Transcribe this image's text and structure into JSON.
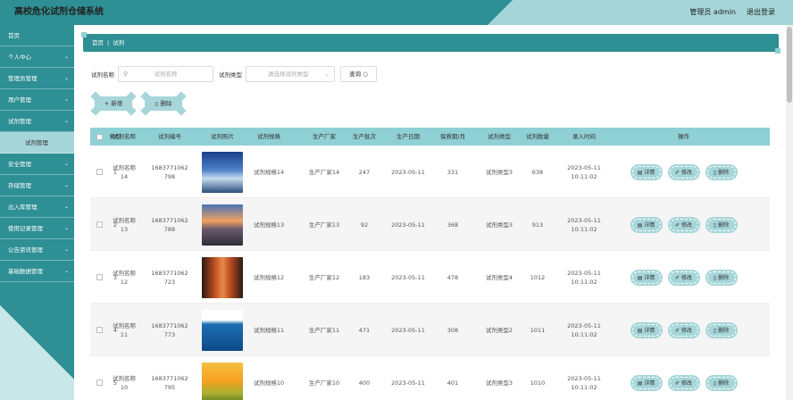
{
  "header": {
    "title": "高校危化试剂仓储系统",
    "user": "管理员 admin",
    "logout": "退出登录"
  },
  "sidebar": {
    "items": [
      {
        "label": "首页",
        "has_chevron": false
      },
      {
        "label": "个人中心",
        "has_chevron": true
      },
      {
        "label": "管理员管理",
        "has_chevron": true
      },
      {
        "label": "用户管理",
        "has_chevron": true
      },
      {
        "label": "试剂管理",
        "has_chevron": true
      },
      {
        "label": "试剂管理",
        "sub": true
      },
      {
        "label": "安全管理",
        "has_chevron": true
      },
      {
        "label": "存储管理",
        "has_chevron": true
      },
      {
        "label": "出入库管理",
        "has_chevron": true
      },
      {
        "label": "使用记录管理",
        "has_chevron": true
      },
      {
        "label": "公告资讯管理",
        "has_chevron": true
      },
      {
        "label": "基础数据管理",
        "has_chevron": true
      }
    ]
  },
  "breadcrumb": {
    "home": "首页",
    "sep": "|",
    "current": "试剂"
  },
  "search": {
    "name_label": "试剂名称",
    "name_placeholder": "试剂名称",
    "type_label": "试剂类型",
    "type_placeholder": "请选择试剂类型",
    "query_button": "查询"
  },
  "actions": {
    "add": "新增",
    "delete": "删除"
  },
  "table": {
    "columns": [
      "索引",
      "试剂名称",
      "试剂编号",
      "试剂照片",
      "试剂规格",
      "生产厂家",
      "生产批次",
      "生产日期",
      "保质期/月",
      "试剂类型",
      "试剂数量",
      "录入时间",
      "操作"
    ],
    "row_buttons": {
      "detail": "详情",
      "edit": "修改",
      "delete": "删除"
    },
    "rows": [
      {
        "index": "1",
        "name": "试剂名称14",
        "code1": "1683771062",
        "code2": "798",
        "img": "img1",
        "spec": "试剂规格14",
        "maker": "生产厂家14",
        "batch": "247",
        "date": "2023-05-11",
        "shelf": "331",
        "type": "试剂类型3",
        "qty": "638",
        "time1": "2023-05-11",
        "time2": "10:11:02"
      },
      {
        "index": "2",
        "name": "试剂名称13",
        "code1": "1683771062",
        "code2": "788",
        "img": "img2",
        "spec": "试剂规格13",
        "maker": "生产厂家13",
        "batch": "92",
        "date": "2023-05-11",
        "shelf": "368",
        "type": "试剂类型3",
        "qty": "913",
        "time1": "2023-05-11",
        "time2": "10:11:02"
      },
      {
        "index": "3",
        "name": "试剂名称12",
        "code1": "1683771062",
        "code2": "723",
        "img": "img3",
        "spec": "试剂规格12",
        "maker": "生产厂家12",
        "batch": "183",
        "date": "2023-05-11",
        "shelf": "478",
        "type": "试剂类型4",
        "qty": "1012",
        "time1": "2023-05-11",
        "time2": "10:11:02"
      },
      {
        "index": "4",
        "name": "试剂名称11",
        "code1": "1683771062",
        "code2": "773",
        "img": "img4",
        "spec": "试剂规格11",
        "maker": "生产厂家11",
        "batch": "471",
        "date": "2023-05-11",
        "shelf": "308",
        "type": "试剂类型2",
        "qty": "1011",
        "time1": "2023-05-11",
        "time2": "10:11:02"
      },
      {
        "index": "5",
        "name": "试剂名称10",
        "code1": "1683771062",
        "code2": "795",
        "img": "img5",
        "spec": "试剂规格10",
        "maker": "生产厂家10",
        "batch": "400",
        "date": "2023-05-11",
        "shelf": "401",
        "type": "试剂类型3",
        "qty": "1010",
        "time1": "2023-05-11",
        "time2": "10:11:02"
      }
    ]
  },
  "icons": {
    "search": "search-icon",
    "chevron": "chevron-down-icon",
    "plus": "plus-icon",
    "trash": "trash-icon",
    "doc": "document-icon",
    "pen": "edit-icon"
  },
  "colors": {
    "primary": "#2e8f94",
    "accent": "#a6d6d9",
    "header_row": "#8fd0d4"
  }
}
